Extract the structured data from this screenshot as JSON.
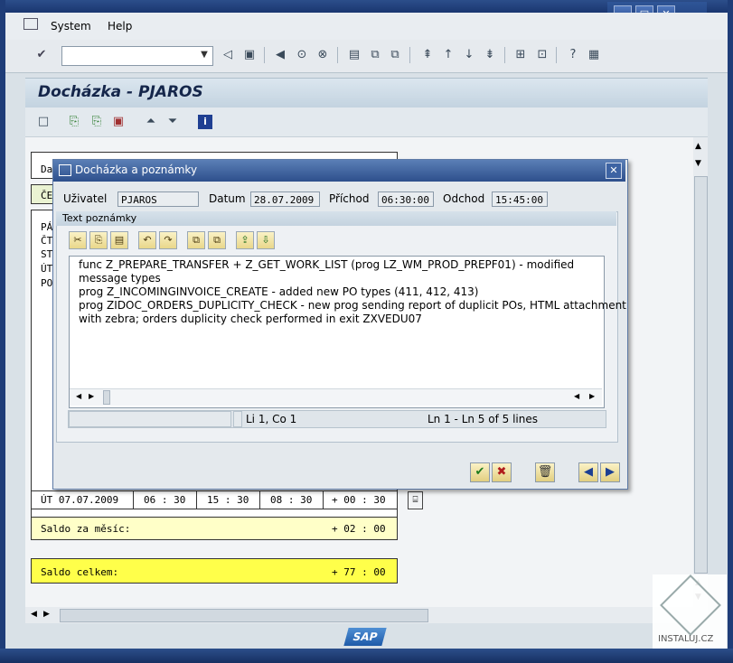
{
  "menu": {
    "system": "System",
    "help": "Help"
  },
  "window_controls": {
    "minimize": "_",
    "maximize": "□",
    "close": "✕"
  },
  "main": {
    "title": "Docházka - PJAROS",
    "table_rows": [
      {
        "text": "Da",
        "bg": "#ffffff"
      },
      {
        "text": "ČE",
        "bg": "#eaf3d2"
      },
      {
        "text": "PÁ",
        "bg": "#ffffff"
      },
      {
        "text": "ČT",
        "bg": "#ffffff"
      },
      {
        "text": "ST",
        "bg": "#ffffff"
      },
      {
        "text": "ÚT",
        "bg": "#ffffff"
      },
      {
        "text": "PO",
        "bg": "#ffffff"
      }
    ],
    "visible_row": {
      "date": "ÚT 07.07.2009",
      "c1": "06 : 30",
      "c2": "15 : 30",
      "c3": "08 : 30",
      "c4": "+ 00 : 30"
    },
    "saldo_month": {
      "label": "Saldo za měsíc:",
      "value": "+ 02 : 00"
    },
    "saldo_total": {
      "label": "Saldo celkem:",
      "value": "+ 77 : 00"
    }
  },
  "dialog": {
    "title": "Docházka a poznámky",
    "user_label": "Uživatel",
    "user_value": "PJAROS",
    "date_label": "Datum",
    "date_value": "28.07.2009",
    "arrival_label": "Příchod",
    "arrival_value": "06:30:00",
    "departure_label": "Odchod",
    "departure_value": "15:45:00",
    "group_title": "Text poznámky",
    "note_lines": [
      "func Z_PREPARE_TRANSFER + Z_GET_WORK_LIST (prog LZ_WM_PROD_PREPF01) - modified",
      "message types",
      "prog Z_INCOMINGINVOICE_CREATE - added new PO types (411, 412, 413)",
      "prog ZIDOC_ORDERS_DUPLICITY_CHECK - new prog sending report of duplicit POs, HTML attachment",
      "with zebra; orders duplicity check performed in exit ZXVEDU07"
    ],
    "status_position": "Li 1, Co 1",
    "status_lines": "Ln 1 - Ln 5 of 5 lines"
  },
  "footer": {
    "logo": "SAP",
    "watermark": "INSTALUJ.CZ"
  },
  "colors": {
    "saldo_month_bg": "#ffffc8",
    "saldo_total_bg": "#ffff4a",
    "accent": "#2d4f8c"
  }
}
